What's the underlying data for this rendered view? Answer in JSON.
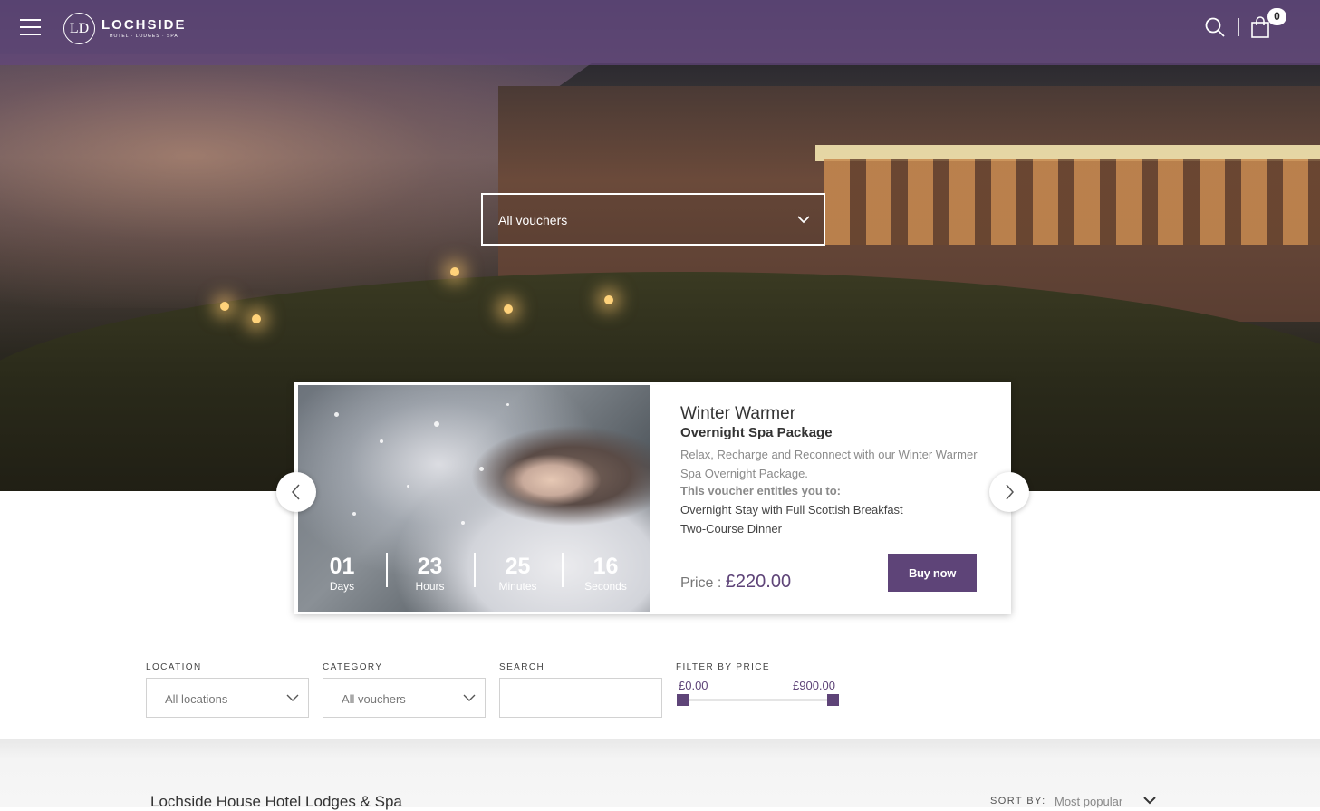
{
  "header": {
    "brand_name": "LOCHSIDE",
    "brand_tagline": "HOTEL · LODGES · SPA",
    "brand_mark": "LD",
    "cart_count": "0",
    "icons": [
      "menu-icon",
      "search-icon",
      "shopping-bag-icon"
    ]
  },
  "hero": {
    "voucher_select": "All vouchers"
  },
  "featured": {
    "title": "Winter Warmer",
    "subtitle": "Overnight Spa Package",
    "description": "Relax, Recharge and Reconnect with our Winter Warmer Spa Overnight Package.",
    "entitles_heading": "This voucher entitles you to:",
    "items": [
      "Overnight Stay with Full Scottish Breakfast",
      "Two-Course Dinner"
    ],
    "price_label": "Price :",
    "price_value": "£220.00",
    "buy_label": "Buy now",
    "countdown": [
      {
        "num": "01",
        "label": "Days"
      },
      {
        "num": "23",
        "label": "Hours"
      },
      {
        "num": "25",
        "label": "Minutes"
      },
      {
        "num": "16",
        "label": "Seconds"
      }
    ]
  },
  "filters": {
    "location_label": "LOCATION",
    "location_value": "All locations",
    "category_label": "CATEGORY",
    "category_value": "All vouchers",
    "search_label": "SEARCH",
    "search_value": "",
    "price_label": "FILTER BY PRICE",
    "price_min": "£0.00",
    "price_max": "£900.00"
  },
  "listing": {
    "title": "Lochside House Hotel Lodges & Spa",
    "sort_label": "SORT BY:",
    "sort_value": "Most popular"
  },
  "colors": {
    "brand_purple": "#5e4478",
    "header_overlay": "#62467d"
  }
}
